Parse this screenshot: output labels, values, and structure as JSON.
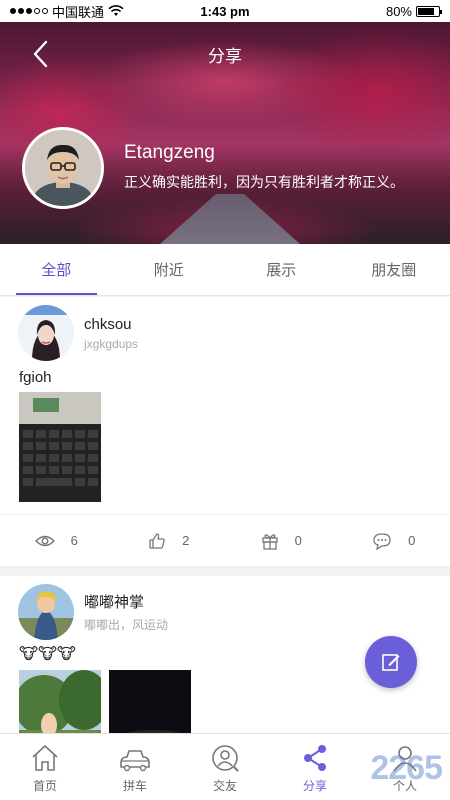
{
  "status_bar": {
    "carrier": "中国联通",
    "time": "1:43 pm",
    "battery": "80%",
    "battery_level": 0.8
  },
  "header": {
    "title": "分享",
    "back_icon": "chevron-left-icon"
  },
  "profile": {
    "name": "Etangzeng",
    "motto": "正义确实能胜利，因为只有胜利者才称正义。"
  },
  "tabs": [
    {
      "label": "全部",
      "active": true
    },
    {
      "label": "附近",
      "active": false
    },
    {
      "label": "展示",
      "active": false
    },
    {
      "label": "朋友圈",
      "active": false
    }
  ],
  "posts": [
    {
      "author": "chksou",
      "subtitle": "jxgkgdups",
      "content": "fgioh",
      "stats": {
        "views": "6",
        "likes": "2",
        "gifts": "0",
        "comments": "0"
      }
    },
    {
      "author": "嘟嘟神掌",
      "subtitle": "嘟嘟出，风运动",
      "content": "🐮🐮🐮"
    }
  ],
  "bottom_nav": [
    {
      "label": "首页",
      "icon": "home-icon"
    },
    {
      "label": "拼车",
      "icon": "car-icon"
    },
    {
      "label": "交友",
      "icon": "friend-search-icon"
    },
    {
      "label": "分享",
      "icon": "share-icon",
      "active": true
    },
    {
      "label": "个人",
      "icon": "person-icon"
    }
  ],
  "watermark": "2265",
  "colors": {
    "accent": "#6a5fd8",
    "tab_accent": "#5b52c9"
  }
}
